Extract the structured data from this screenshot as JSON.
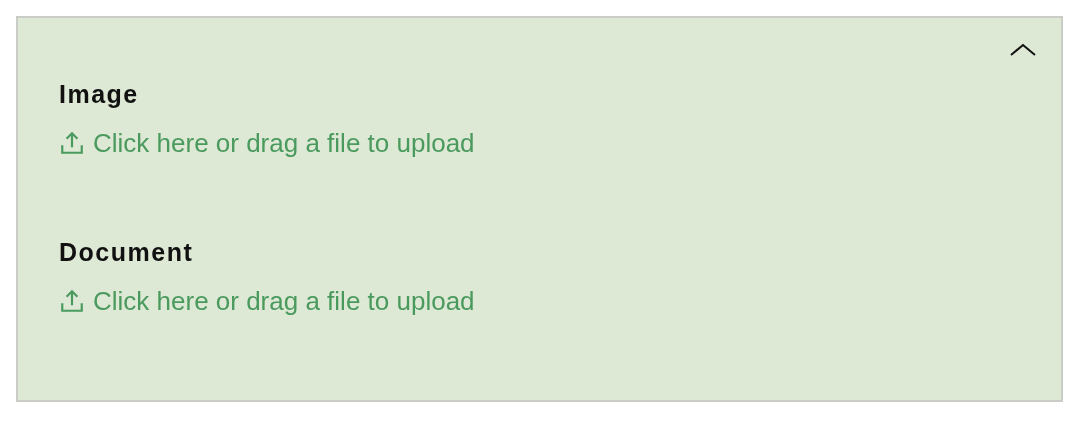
{
  "panel": {
    "expanded": true,
    "fields": [
      {
        "label": "Image",
        "action": "Click here or drag a file to upload"
      },
      {
        "label": "Document",
        "action": "Click here or drag a file to upload"
      }
    ]
  }
}
